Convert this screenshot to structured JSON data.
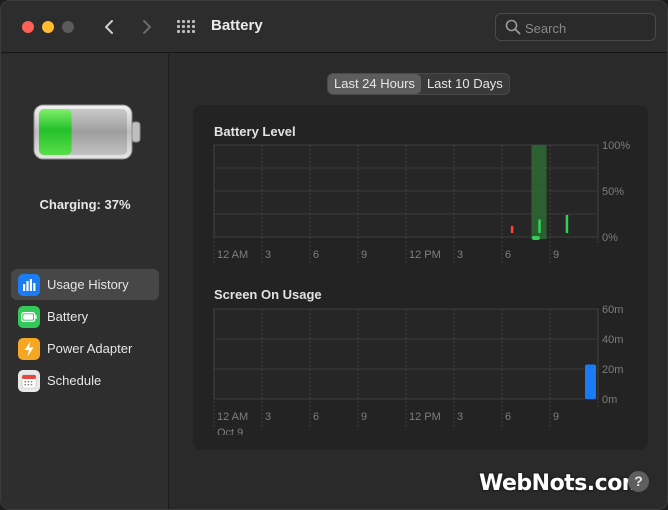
{
  "window": {
    "title": "Battery"
  },
  "search": {
    "placeholder": "Search"
  },
  "battery": {
    "status_text": "Charging: 37%",
    "level": 0.37,
    "fill_color": "#35c94a"
  },
  "sidebar": {
    "items": [
      {
        "label": "Usage History",
        "icon": "bar-chart-icon",
        "icon_color": "#1b7cf3",
        "active": true
      },
      {
        "label": "Battery",
        "icon": "battery-icon",
        "icon_color": "#34c759",
        "active": false
      },
      {
        "label": "Power Adapter",
        "icon": "lightning-bolt-icon",
        "icon_color": "#f5a623",
        "active": false
      },
      {
        "label": "Schedule",
        "icon": "calendar-icon",
        "icon_color": "#e8e8e8",
        "active": false
      }
    ]
  },
  "range_selector": {
    "options": [
      "Last 24 Hours",
      "Last 10 Days"
    ],
    "selected": "Last 24 Hours"
  },
  "watermark": {
    "text": "WebNots.com"
  },
  "help": {
    "label": "?"
  },
  "chart_data": [
    {
      "type": "bar",
      "title": "Battery Level",
      "categories": [
        "12 AM",
        "3",
        "6",
        "9",
        "12 PM",
        "3",
        "6",
        "9"
      ],
      "y_tick_labels": [
        "100%",
        "50%",
        "0%"
      ],
      "ylim": [
        0,
        100
      ],
      "series": [
        {
          "values": [
            0,
            0,
            0,
            0,
            0,
            0,
            0,
            0,
            0,
            0,
            0,
            0,
            0,
            0,
            0,
            0,
            0,
            0,
            0,
            0,
            0,
            0,
            0,
            8,
            0,
            25,
            0,
            37
          ]
        }
      ],
      "charging_indicator": true,
      "colors": {
        "bar": "#30d158",
        "low": "#ff453a",
        "charging_band": "#2f6b33"
      }
    },
    {
      "type": "bar",
      "title": "Screen On Usage",
      "categories": [
        "12 AM",
        "3",
        "6",
        "9",
        "12 PM",
        "3",
        "6",
        "9"
      ],
      "date_label": "Oct 9",
      "y_tick_labels": [
        "60m",
        "40m",
        "20m",
        "0m"
      ],
      "ylim": [
        0,
        60
      ],
      "series": [
        {
          "values": [
            0,
            0,
            0,
            0,
            0,
            0,
            0,
            0,
            0,
            0,
            0,
            0,
            0,
            0,
            0,
            0,
            0,
            0,
            0,
            0,
            0,
            0,
            0,
            23
          ]
        }
      ],
      "colors": {
        "bar": "#1a7cf5"
      }
    }
  ]
}
